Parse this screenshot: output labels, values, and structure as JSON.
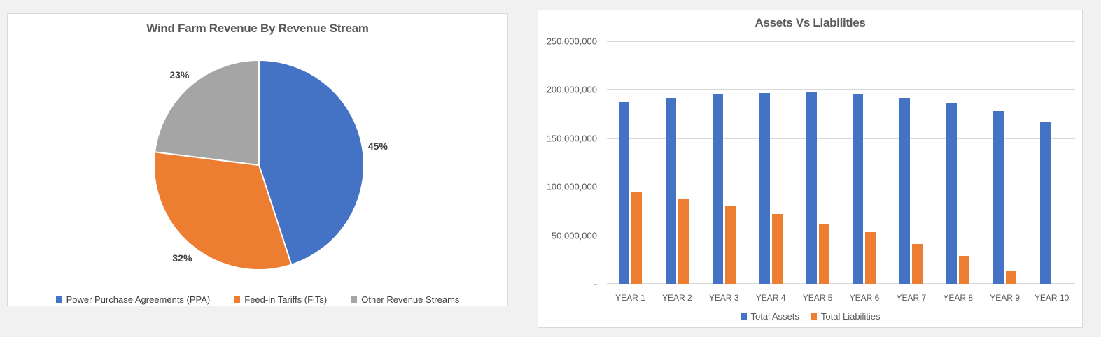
{
  "chart_data": [
    {
      "type": "pie",
      "title": "Wind Farm Revenue By Revenue Stream",
      "labels": [
        "Power Purchase Agreements (PPA)",
        "Feed-in Tariffs (FiTs)",
        "Other Revenue Streams"
      ],
      "values": [
        45,
        32,
        23
      ],
      "data_labels": [
        "45%",
        "32%",
        "23%"
      ],
      "colors": [
        "#4472C4",
        "#ED7D31",
        "#A5A5A5"
      ],
      "start_angle_deg": 0,
      "direction": "clockwise",
      "legend_position": "bottom"
    },
    {
      "type": "bar",
      "title": "Assets Vs Liabilities",
      "categories": [
        "YEAR 1",
        "YEAR 2",
        "YEAR 3",
        "YEAR 4",
        "YEAR 5",
        "YEAR 6",
        "YEAR 7",
        "YEAR 8",
        "YEAR 9",
        "YEAR 10"
      ],
      "series": [
        {
          "name": "Total Assets",
          "color": "#4472C4",
          "values": [
            187000000,
            192000000,
            195000000,
            197000000,
            198000000,
            196000000,
            192000000,
            186000000,
            178000000,
            167000000
          ]
        },
        {
          "name": "Total Liabilities",
          "color": "#ED7D31",
          "values": [
            95000000,
            88000000,
            80000000,
            72000000,
            62000000,
            53000000,
            41000000,
            29000000,
            14000000,
            0
          ]
        }
      ],
      "ylim": [
        0,
        250000000
      ],
      "ytick_step": 50000000,
      "ytick_labels": [
        "-",
        "50,000,000",
        "100,000,000",
        "150,000,000",
        "200,000,000",
        "250,000,000"
      ],
      "grid": true,
      "legend_position": "bottom"
    }
  ]
}
